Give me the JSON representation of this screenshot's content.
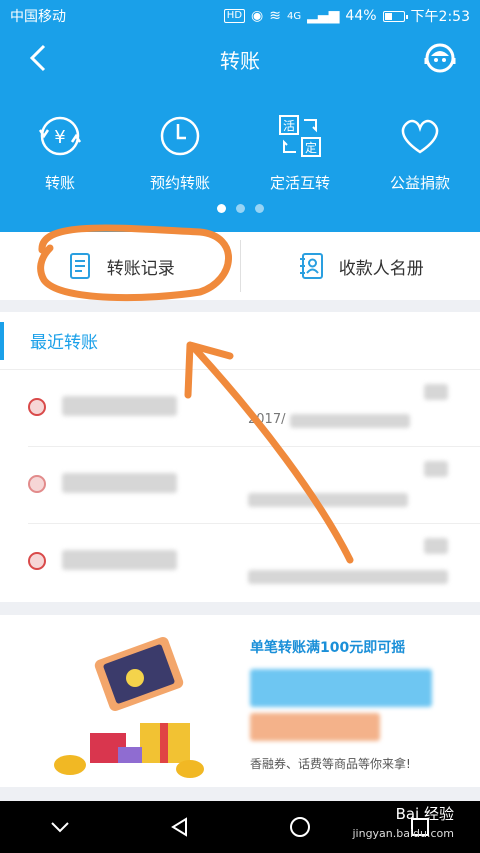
{
  "status_bar": {
    "carrier": "中国移动",
    "network_badge": "HD",
    "signal_label": "4G",
    "battery": "44%",
    "battery_level": 0.44,
    "time": "下午2:53"
  },
  "header": {
    "title": "转账",
    "quick_actions": [
      {
        "label": "转账",
        "icon": "yen-transfer-icon"
      },
      {
        "label": "预约转账",
        "icon": "clock-icon"
      },
      {
        "label": "定活互转",
        "icon": "fixed-current-swap-icon"
      },
      {
        "label": "公益捐款",
        "icon": "heart-icon"
      }
    ],
    "page_count": 3,
    "active_page": 1
  },
  "records": {
    "history_label": "转账记录",
    "payee_label": "收款人名册"
  },
  "recent": {
    "title": "最近转账",
    "rows": [
      {
        "date_fragment": "2017/"
      },
      {
        "date_fragment": ""
      },
      {
        "date_fragment": ""
      }
    ]
  },
  "banner": {
    "title": "单笔转账满100元即可摇",
    "footer": "香融券、话费等商品等你来拿!"
  },
  "watermark": {
    "brand": "Bai 经验",
    "url": "jingyan.baidu.com"
  },
  "colors": {
    "primary": "#1aa0e9",
    "annotation": "#f08a3c"
  }
}
